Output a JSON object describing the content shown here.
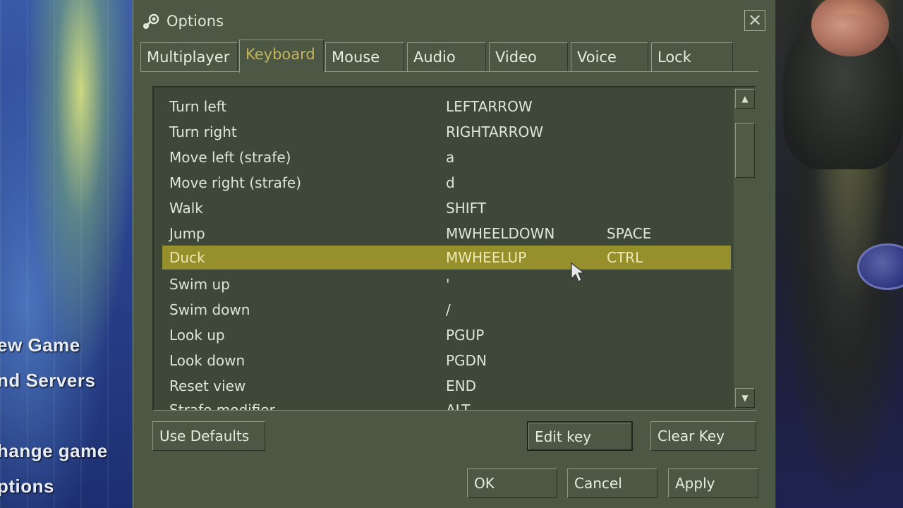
{
  "background_menu": {
    "items": [
      "ew Game",
      "nd Servers",
      "hange game",
      "ptions"
    ]
  },
  "dialog": {
    "title": "Options",
    "close_glyph": "✕",
    "tabs": [
      {
        "label": "Multiplayer",
        "active": false
      },
      {
        "label": "Keyboard",
        "active": true
      },
      {
        "label": "Mouse",
        "active": false
      },
      {
        "label": "Audio",
        "active": false
      },
      {
        "label": "Video",
        "active": false
      },
      {
        "label": "Voice",
        "active": false
      },
      {
        "label": "Lock",
        "active": false
      }
    ],
    "bindings": [
      {
        "action": "Turn left",
        "key": "LEFTARROW",
        "alt": ""
      },
      {
        "action": "Turn right",
        "key": "RIGHTARROW",
        "alt": ""
      },
      {
        "action": "Move left (strafe)",
        "key": "a",
        "alt": ""
      },
      {
        "action": "Move right (strafe)",
        "key": "d",
        "alt": ""
      },
      {
        "action": "Walk",
        "key": "SHIFT",
        "alt": ""
      },
      {
        "action": "Jump",
        "key": "MWHEELDOWN",
        "alt": "SPACE"
      },
      {
        "action": "Duck",
        "key": "MWHEELUP",
        "alt": "CTRL"
      },
      {
        "action": "Swim up",
        "key": "'",
        "alt": ""
      },
      {
        "action": "Swim down",
        "key": "/",
        "alt": ""
      },
      {
        "action": "Look up",
        "key": "PGUP",
        "alt": ""
      },
      {
        "action": "Look down",
        "key": "PGDN",
        "alt": ""
      },
      {
        "action": "Reset view",
        "key": "END",
        "alt": ""
      },
      {
        "action": "Strafe modifier",
        "key": "ALT",
        "alt": ""
      }
    ],
    "selected_row": 6,
    "scroll_up_glyph": "▲",
    "scroll_down_glyph": "▼",
    "buttons": {
      "use_defaults": "Use Defaults",
      "edit_key": "Edit key",
      "clear_key": "Clear Key",
      "ok": "OK",
      "cancel": "Cancel",
      "apply": "Apply"
    }
  },
  "icons": {
    "title_icon": "steam-logo-icon",
    "cursor": "mouse-pointer-icon"
  },
  "colors": {
    "panel": "#4c5844",
    "list": "#3e4838",
    "selection": "#96902c",
    "active_tab_text": "#c4b55a"
  }
}
